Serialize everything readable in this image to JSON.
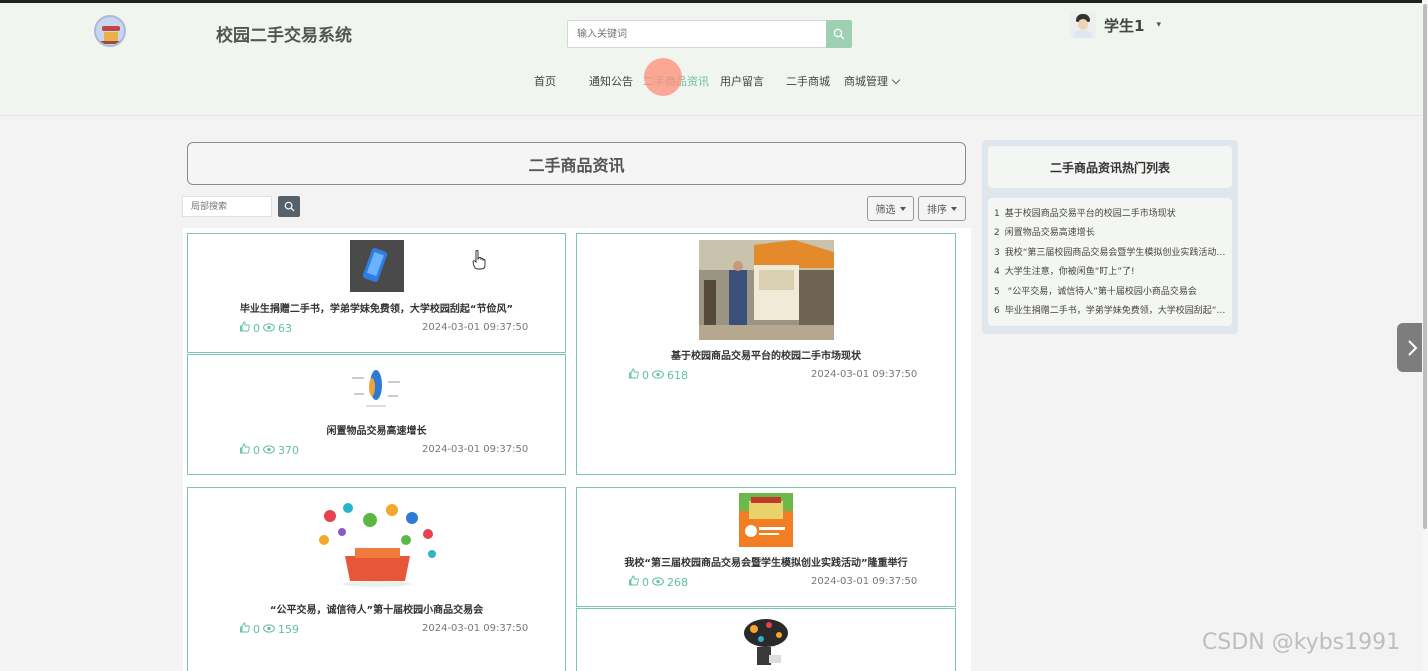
{
  "header": {
    "site_title": "校园二手交易系统",
    "search_placeholder": "输入关键词",
    "username": "学生1",
    "user_caret": "▾"
  },
  "nav": {
    "items": [
      {
        "label": "首页"
      },
      {
        "label": "通知公告"
      },
      {
        "label": "二手商品资讯"
      },
      {
        "label": "用户留言"
      },
      {
        "label": "二手商城"
      },
      {
        "label": "商城管理"
      }
    ],
    "active_index": 2
  },
  "main": {
    "heading": "二手商品资讯",
    "local_search_placeholder": "局部搜索",
    "filter_label": "筛选",
    "sort_label": "排序"
  },
  "articles": [
    {
      "title": "毕业生捐赠二手书，学弟学妹免费领，大学校园刮起“节俭风”",
      "likes": "0",
      "views": "63",
      "date": "2024-03-01 09:37:50"
    },
    {
      "title": "基于校园商品交易平台的校园二手市场现状",
      "likes": "0",
      "views": "618",
      "date": "2024-03-01 09:37:50"
    },
    {
      "title": "闲置物品交易高速增长",
      "likes": "0",
      "views": "370",
      "date": "2024-03-01 09:37:50"
    },
    {
      "title": "“公平交易，诚信待人”第十届校园小商品交易会",
      "likes": "0",
      "views": "159",
      "date": "2024-03-01 09:37:50"
    },
    {
      "title": "我校“第三届校园商品交易会暨学生模拟创业实践活动”隆重举行",
      "likes": "0",
      "views": "268",
      "date": "2024-03-01 09:37:50"
    }
  ],
  "sidebar": {
    "title": "二手商品资讯热门列表",
    "items": [
      {
        "num": "1",
        "text": "基于校园商品交易平台的校园二手市场现状"
      },
      {
        "num": "2",
        "text": "闲置物品交易高速增长"
      },
      {
        "num": "3",
        "text": "我校“第三届校园商品交易会暨学生模拟创业实践活动”隆重举行"
      },
      {
        "num": "4",
        "text": "大学生注意，你被闲鱼“盯上”了!"
      },
      {
        "num": "5",
        "text": " “公平交易，诚信待人”第十届校园小商品交易会"
      },
      {
        "num": "6",
        "text": "毕业生捐赠二手书，学弟学妹免费领，大学校园刮起“节俭风”"
      }
    ]
  },
  "watermark": "CSDN @kybs1991",
  "colors": {
    "accent": "#6cc0a6",
    "card_border": "#7cc4b8",
    "header_bg": "#f1f5ef"
  }
}
